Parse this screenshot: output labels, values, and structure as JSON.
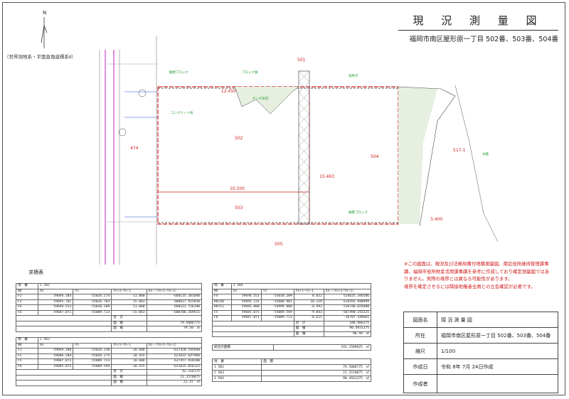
{
  "header": {
    "title": "現 況 測 量 図",
    "subtitle": "福岡市南区屋形原一丁目 502番、503番、504番",
    "crs": "（世界測地系・平面直角座標系Ⅱ）",
    "north": "N"
  },
  "plan": {
    "lot_labels": [
      "502",
      "503",
      "504",
      "474",
      "501",
      "505",
      "517-1"
    ],
    "road_label": "水路",
    "dims": [
      "10.500",
      "12.450",
      "15.463",
      "3.400"
    ],
    "annotations": [
      "擁壁ブロック",
      "境界点",
      "ブロック塀",
      "コンクリート杭",
      "ゲンチ矢印"
    ]
  },
  "notes": [
    "※この図面は、現況及び法務局備付地積測量図、南区役所維持管理課事",
    "蹟、福岡市役所財産活用課事蹟を参考に作成しており確定測量図ではあ",
    "りません。実際の境界とは異なる可能性があります。",
    "境界を確定させるには隣接地権者全員との立会確認が必要です。"
  ],
  "tables": {
    "title": "求積表",
    "t502": {
      "header": [
        "地　番",
        "1 502",
        "",
        "",
        ""
      ],
      "cols": [
        "NO",
        "Xn",
        "Yn",
        "Yn+1−Yn−1",
        "Xn・（Yn+1−Yn−1）"
      ],
      "rows": [
        [
          "F2",
          "59694.284",
          "-55026.274",
          "-11.060",
          "-660135.301040"
        ],
        [
          "F3",
          "59693.782",
          "-55026.783",
          "15.063",
          "608617.915830"
        ],
        [
          "F4",
          "59694.553",
          "-55010.209",
          "11.060",
          "660221.756190"
        ],
        [
          "F6",
          "59687.071",
          "-55009.723",
          "-15.063",
          "-608706.369615"
        ]
      ],
      "sum_label": "合　計",
      "sum": "",
      "area_label": "面　積",
      "double": "79.5006775",
      "area": "79.50　㎡"
    },
    "t503": {
      "header": [
        "地　番",
        "2 503",
        "",
        "",
        ""
      ],
      "cols": [
        "NO",
        "Xn",
        "Yn",
        "Yn+1−Yn−1",
        "Xn・（Yn+1−Yn−1）"
      ],
      "rows": [
        [
          "F1",
          "59694.288",
          "-55026.138",
          "-10.680",
          "-637428.195840"
        ],
        [
          "F2",
          "59686.284",
          "-55026.274",
          "10.415",
          "621632.647960"
        ],
        [
          "F5",
          "59687.071",
          "-55009.723",
          "10.680",
          "637457.918280"
        ],
        [
          "F6",
          "59685.075",
          "-55009.594",
          "-10.415",
          "-621625.056125"
        ]
      ],
      "sum_label": "合　計",
      "sum": "42.314175",
      "area_label": "面　積",
      "double": "21.1570875",
      "area": "21.15　㎡"
    },
    "t504": {
      "header": [
        "地　番",
        "3 504",
        "",
        "",
        ""
      ],
      "cols": [
        "NO",
        "Xn",
        "Yn",
        "Yn+1−Yn−1",
        "Xn・（Yn+1−Yn−1）"
      ],
      "rows": [
        [
          "F4",
          "59694.553",
          "-55010.209",
          "8.822",
          "526625.346586"
        ],
        [
          "KK148",
          "59695.231",
          "-55000.901",
          "10.329",
          "616592.940999"
        ],
        [
          "KK152",
          "59685.800",
          "-54999.880",
          "-8.993",
          "-536748.659400"
        ],
        [
          "F5",
          "59685.075",
          "-55009.594",
          "-9.843",
          "-587490.193225"
        ],
        [
          "F6",
          "59687.071",
          "-55009.723",
          "-0.615",
          "-36707.548665"
        ]
      ],
      "sum_label": "合　計",
      "sum": "180.986275",
      "area_label": "面　積",
      "double": "90.4931375",
      "area": "90.49　㎡"
    },
    "total": {
      "label": "総合計面積",
      "value": "191.1509025　㎡",
      "cols": [
        "地　番",
        "面　積"
      ],
      "rows": [
        [
          "1 502",
          "79.5006775　㎡"
        ],
        [
          "2 503",
          "21.1570875　㎡"
        ],
        [
          "3 504",
          "90.4931375　㎡"
        ]
      ]
    }
  },
  "info": [
    {
      "k": "図面名",
      "v": "現 況 測 量 図"
    },
    {
      "k": "所在",
      "v": "福岡市南区屋形原一丁目 502番、503番、504番"
    },
    {
      "k": "縮尺",
      "v": "1/100"
    },
    {
      "k": "作成日",
      "v": "令和 8年 7月 24日作成"
    },
    {
      "k": "作成者",
      "v": ""
    }
  ]
}
